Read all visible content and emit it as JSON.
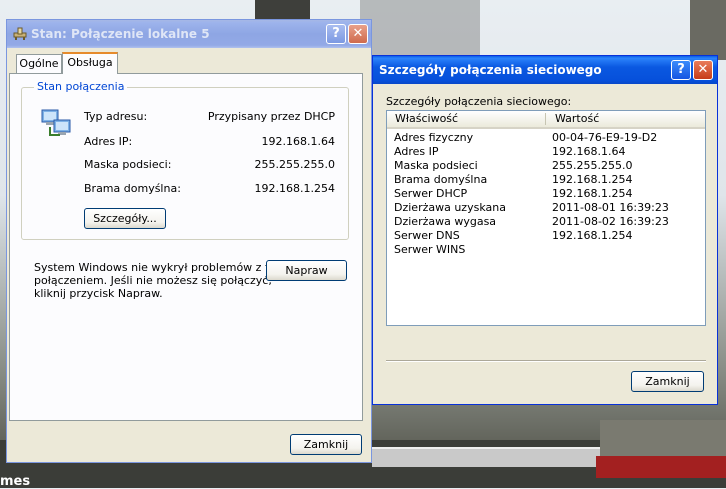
{
  "desktop": {
    "bg_text": "mes"
  },
  "left_window": {
    "title": "Stan: Połączenie lokalne 5",
    "tabs": [
      {
        "label": "Ogólne",
        "selected": false
      },
      {
        "label": "Obsługa",
        "selected": true
      }
    ],
    "group_title": "Stan połączenia",
    "fields": [
      {
        "label": "Typ adresu:",
        "value": "Przypisany przez DHCP"
      },
      {
        "label": "Adres IP:",
        "value": "192.168.1.64"
      },
      {
        "label": "Maska podsieci:",
        "value": "255.255.255.0"
      },
      {
        "label": "Brama domyślna:",
        "value": "192.168.1.254"
      }
    ],
    "details_button": "Szczegóły...",
    "repair_text": [
      "System Windows nie wykrył problemów z tym",
      "połączeniem. Jeśli nie możesz się połączyć,",
      "kliknij przycisk Napraw."
    ],
    "repair_button": "Napraw",
    "close_button": "Zamknij",
    "help_glyph": "?",
    "close_glyph": "✕"
  },
  "right_window": {
    "title": "Szczegóły połączenia sieciowego",
    "caption": "Szczegóły połączenia sieciowego:",
    "columns": [
      "Właściwość",
      "Wartość"
    ],
    "rows": [
      [
        "Adres fizyczny",
        "00-04-76-E9-19-D2"
      ],
      [
        "Adres IP",
        "192.168.1.64"
      ],
      [
        "Maska podsieci",
        "255.255.255.0"
      ],
      [
        "Brama domyślna",
        "192.168.1.254"
      ],
      [
        "Serwer DHCP",
        "192.168.1.254"
      ],
      [
        "Dzierżawa uzyskana",
        "2011-08-01 16:39:23"
      ],
      [
        "Dzierżawa wygasa",
        "2011-08-02 16:39:23"
      ],
      [
        "Serwer DNS",
        "192.168.1.254"
      ],
      [
        "Serwer WINS",
        ""
      ]
    ],
    "close_button": "Zamknij",
    "help_glyph": "?",
    "close_glyph": "✕"
  },
  "colors": {
    "active_title": "#0a58e1",
    "inactive_title": "#93a9e6",
    "dialog_bg": "#ece9d8",
    "group_title": "#0046d5"
  }
}
